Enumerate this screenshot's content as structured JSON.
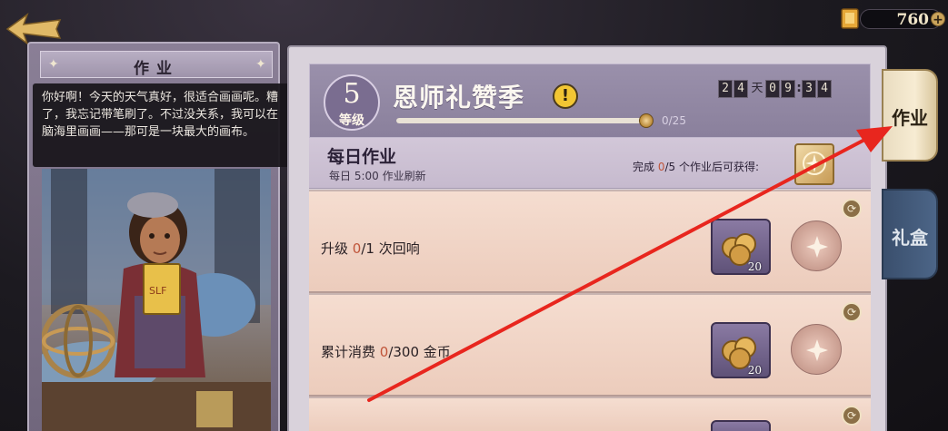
{
  "top_bar": {
    "currency_amount": "760",
    "currency_plus": "+"
  },
  "left_panel": {
    "title": "作业",
    "dialogue": "你好啊！今天的天气真好，很适合画画呢。糟了，我忘记带笔刷了。不过没关系，我可以在脑海里画画——那可是一块最大的画布。",
    "notepad_text": "SLF"
  },
  "season": {
    "level_number": "5",
    "level_label": "等级",
    "title": "恩师礼赞季",
    "info_mark": "!",
    "progress_text": "0/25",
    "progress_fraction": 0.97,
    "timer": {
      "days": [
        "2",
        "4"
      ],
      "day_label": "天",
      "hours": [
        "0",
        "9"
      ],
      "minutes": [
        "3",
        "4"
      ],
      "sep": ":"
    }
  },
  "daily": {
    "title": "每日作业",
    "refresh_note": "每日 5:00 作业刷新",
    "reward_prefix": "完成 ",
    "reward_count": "0",
    "reward_suffix": "/5 个作业后可获得:"
  },
  "tasks": [
    {
      "prefix": "升级 ",
      "progress": "0",
      "suffix": "/1 次回响",
      "reward_qty": "20"
    },
    {
      "prefix": "累计消费 ",
      "progress": "0",
      "suffix": "/300 金币",
      "reward_qty": "20"
    }
  ],
  "tabs": {
    "active": "作业",
    "inactive": "礼盒"
  },
  "colors": {
    "accent_red": "#e8261e",
    "highlight_text": "#c0553a",
    "panel_purple": "#9a90ab"
  }
}
